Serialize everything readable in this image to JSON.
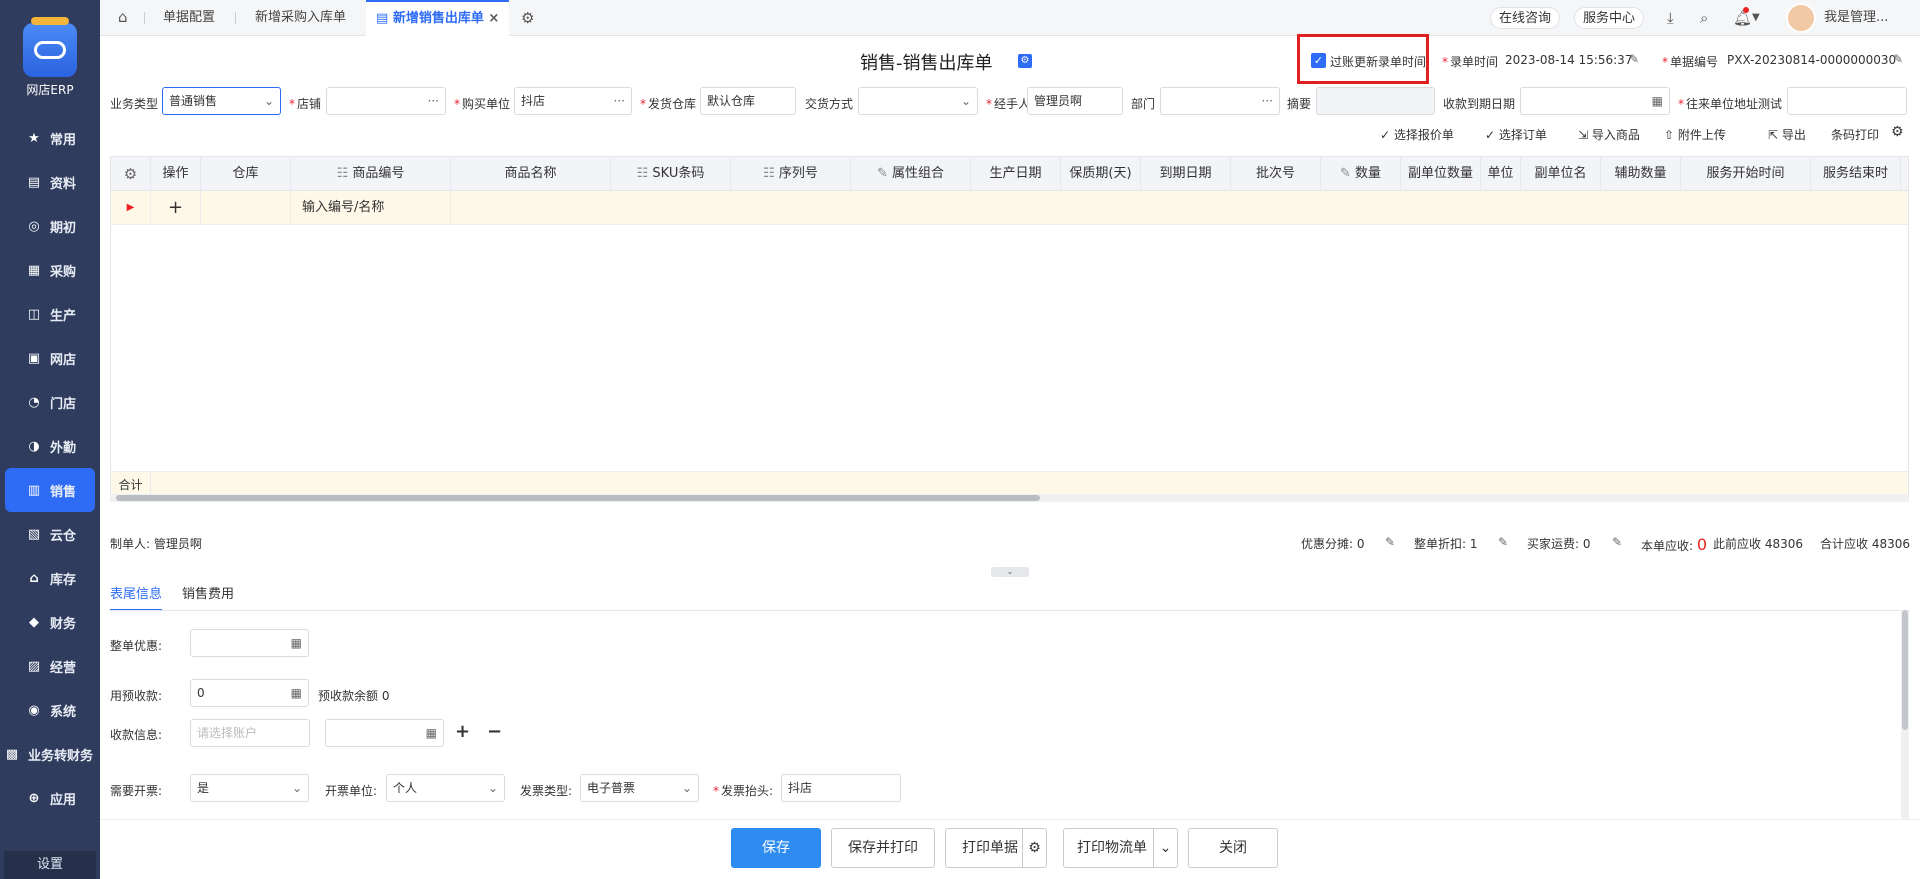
{
  "app": {
    "name": "网店ERP",
    "settings": "设置"
  },
  "sidebar": {
    "items": [
      {
        "label": "常用",
        "icon": "★"
      },
      {
        "label": "资料",
        "icon": "▤"
      },
      {
        "label": "期初",
        "icon": "◎"
      },
      {
        "label": "采购",
        "icon": "▦"
      },
      {
        "label": "生产",
        "icon": "◫"
      },
      {
        "label": "网店",
        "icon": "▣"
      },
      {
        "label": "门店",
        "icon": "◔"
      },
      {
        "label": "外勤",
        "icon": "◑"
      },
      {
        "label": "销售",
        "icon": "▥"
      },
      {
        "label": "云仓",
        "icon": "▧"
      },
      {
        "label": "库存",
        "icon": "⌂"
      },
      {
        "label": "财务",
        "icon": "◆"
      },
      {
        "label": "经营",
        "icon": "▨"
      },
      {
        "label": "系统",
        "icon": "◉"
      },
      {
        "label": "业务转财务",
        "icon": "▩"
      },
      {
        "label": "应用",
        "icon": "⊕"
      }
    ],
    "active_index": 8
  },
  "tabs": {
    "home_icon": "⌂",
    "items": [
      "单据配置",
      "新增采购入库单",
      "新增销售出库单"
    ],
    "close": "×"
  },
  "topright": {
    "consult": "在线咨询",
    "service": "服务中心",
    "user": "我是管理..."
  },
  "header": {
    "title": "销售-销售出库单",
    "refresh_label": "过账更新录单时间",
    "time_label": "录单时间",
    "time_value": "2023-08-14 15:56:37",
    "no_label": "单据编号",
    "no_value": "PXX-20230814-0000000030"
  },
  "form": {
    "biz_type_label": "业务类型",
    "biz_type_value": "普通销售",
    "shop_label": "店铺",
    "shop_value": "",
    "buyer_label": "购买单位",
    "buyer_value": "抖店",
    "warehouse_label": "发货仓库",
    "warehouse_value": "默认仓库",
    "deal_label": "交货方式",
    "deal_value": "",
    "handler_label": "经手人",
    "handler_value": "管理员啊",
    "dept_label": "部门",
    "dept_value": "",
    "memo_label": "摘要",
    "memo_value": "",
    "due_label": "收款到期日期",
    "due_value": "",
    "addr_label": "往来单位地址测试",
    "addr_value": ""
  },
  "toolbar": {
    "quote": "选择报价单",
    "order": "选择订单",
    "import": "导入商品",
    "attach": "附件上传",
    "export": "导出",
    "barcode": "条码打印"
  },
  "grid": {
    "columns": [
      "操作",
      "仓库",
      "商品编号",
      "商品名称",
      "SKU条码",
      "序列号",
      "属性组合",
      "生产日期",
      "保质期(天)",
      "到期日期",
      "批次号",
      "数量",
      "副单位数量",
      "单位",
      "副单位名",
      "辅助数量",
      "服务开始时间",
      "服务结束时"
    ],
    "input_placeholder": "输入编号/名称",
    "total_label": "合计",
    "add": "+"
  },
  "summary": {
    "maker_label": "制单人:",
    "maker_value": "管理员啊",
    "discount_share_label": "优惠分摊:",
    "discount_share_value": "0",
    "overall_discount_label": "整单折扣:",
    "overall_discount_value": "1",
    "buyer_freight_label": "买家运费:",
    "buyer_freight_value": "0",
    "due_label": "本单应收:",
    "due_value": "0",
    "prev_due_label": "此前应收",
    "prev_due_value": "48306",
    "total_due_label": "合计应收",
    "total_due_value": "48306"
  },
  "subtabs": [
    "表尾信息",
    "销售费用"
  ],
  "footer_form": {
    "order_discount_label": "整单优惠:",
    "order_discount_value": "",
    "prepay_label": "用预收款:",
    "prepay_value": "0",
    "prepay_balance": "预收款余额 0",
    "collect_label": "收款信息:",
    "collect_placeholder": "请选择账户",
    "collect_amount": "",
    "invoice_need_label": "需要开票:",
    "invoice_need_value": "是",
    "invoice_unit_label": "开票单位:",
    "invoice_unit_value": "个人",
    "invoice_type_label": "发票类型:",
    "invoice_type_value": "电子普票",
    "invoice_title_label": "发票抬头:",
    "invoice_title_value": "抖店"
  },
  "buttons": {
    "save": "保存",
    "save_print": "保存并打印",
    "print_doc": "打印单据",
    "print_logistics": "打印物流单",
    "close": "关闭"
  }
}
